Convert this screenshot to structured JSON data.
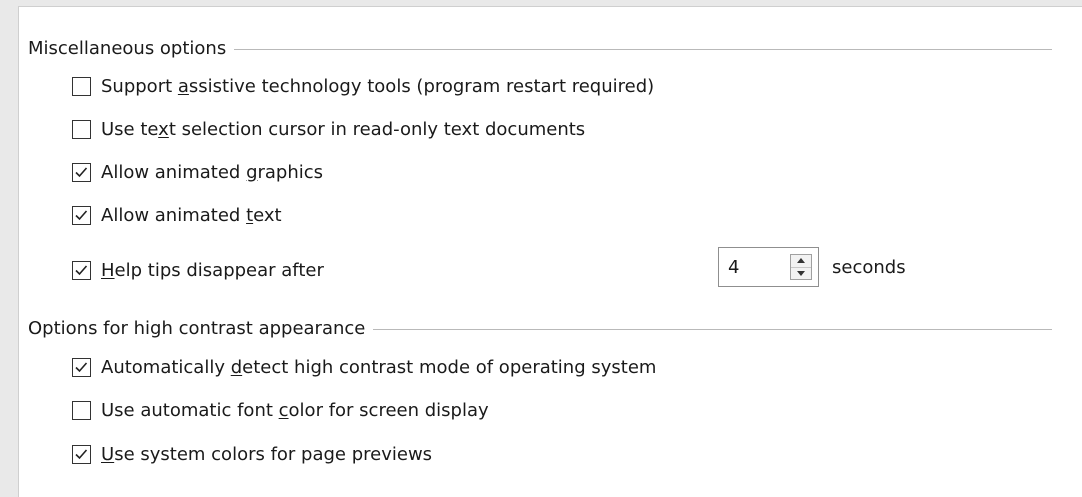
{
  "misc": {
    "title": "Miscellaneous options",
    "options": [
      {
        "pre": "Support ",
        "mn": "a",
        "post": "ssistive technology tools (program restart required)",
        "checked": false
      },
      {
        "pre": "Use te",
        "mn": "x",
        "post": "t selection cursor in read-only text documents",
        "checked": false
      },
      {
        "pre": "Allow animated ",
        "mn": "g",
        "post": "raphics",
        "checked": true
      },
      {
        "pre": "Allow animated ",
        "mn": "t",
        "post": "ext",
        "checked": true
      },
      {
        "pre": "",
        "mn": "H",
        "post": "elp tips disappear after",
        "checked": true
      }
    ],
    "help_tips_value": "4",
    "seconds_label": "seconds"
  },
  "contrast": {
    "title": "Options for high contrast appearance",
    "options": [
      {
        "pre": "Automatically ",
        "mn": "d",
        "post": "etect high contrast mode of operating system",
        "checked": true
      },
      {
        "pre": "Use automatic font ",
        "mn": "c",
        "post": "olor for screen display",
        "checked": false
      },
      {
        "pre": "",
        "mn": "U",
        "post": "se system colors for page previews",
        "checked": true
      }
    ]
  },
  "icons": {
    "check": "checkmark-icon",
    "spin_up": "spin-up-icon",
    "spin_down": "spin-down-icon"
  }
}
